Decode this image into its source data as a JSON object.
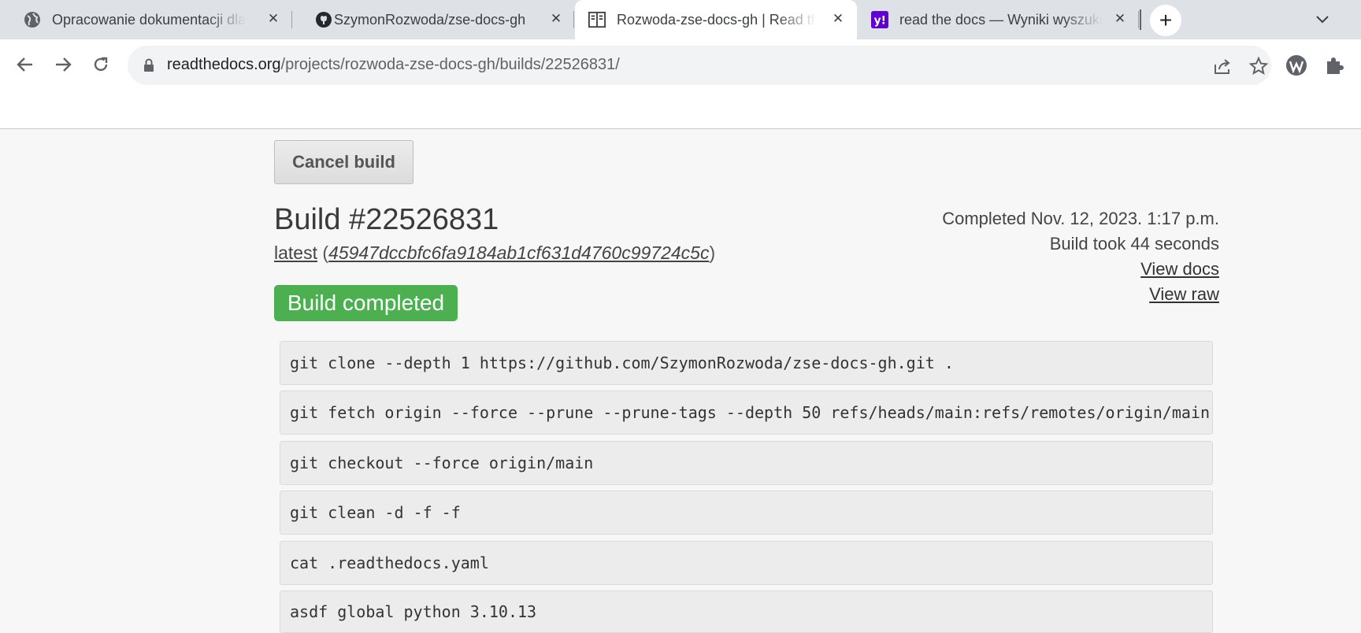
{
  "tabs": [
    {
      "title": "Opracowanie dokumentacji dla projektu",
      "icon": "globe-icon",
      "active": false
    },
    {
      "title": "SzymonRozwoda/zse-docs-gh",
      "icon": "github-icon",
      "active": false
    },
    {
      "title": "Rozwoda-zse-docs-gh | Read the Docs",
      "icon": "readthedocs-icon",
      "active": true
    },
    {
      "title": "read the docs — Wyniki wyszukiwania",
      "icon": "yahoo-icon",
      "active": false
    }
  ],
  "address_bar": {
    "domain": "readthedocs.org",
    "path": "/projects/rozwoda-zse-docs-gh/builds/22526831/"
  },
  "page": {
    "cancel_label": "Cancel build",
    "build_title": "Build #22526831",
    "version": "latest",
    "commit": "45947dccbfc6fa9184ab1cf631d4760c99724c5c",
    "open_paren": " (",
    "close_paren": ")",
    "status": "Build completed",
    "completed": "Completed Nov. 12, 2023. 1:17 p.m.",
    "duration": "Build took 44 seconds",
    "view_docs": "View docs",
    "view_raw": "View raw",
    "commands": [
      "git clone --depth 1 https://github.com/SzymonRozwoda/zse-docs-gh.git .",
      "git fetch origin --force --prune --prune-tags --depth 50 refs/heads/main:refs/remotes/origin/main",
      "git checkout --force origin/main",
      "git clean -d -f -f",
      "cat .readthedocs.yaml",
      "asdf global python 3.10.13"
    ]
  },
  "colors": {
    "status_green": "#4caf50",
    "tabstrip": "#dee1e6"
  }
}
